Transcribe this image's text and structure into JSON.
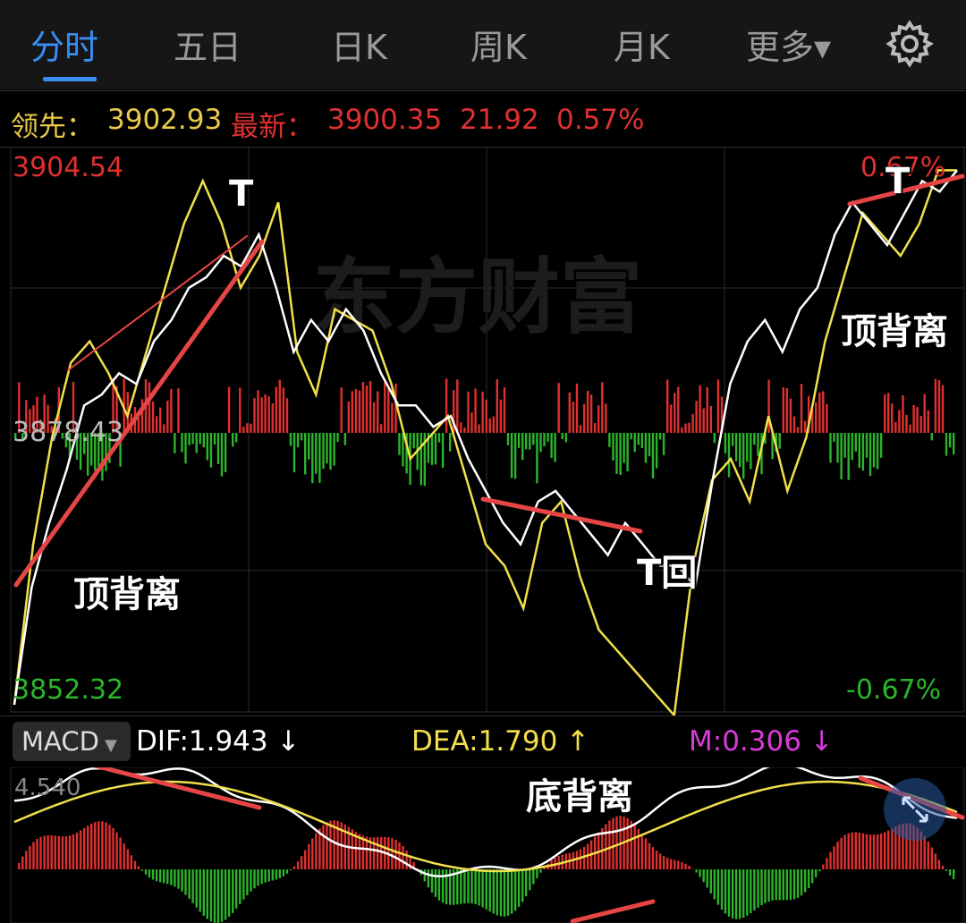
{
  "tabs": [
    {
      "label": "分时",
      "active": true
    },
    {
      "label": "五日",
      "active": false
    },
    {
      "label": "日K",
      "active": false
    },
    {
      "label": "周K",
      "active": false
    },
    {
      "label": "月K",
      "active": false
    },
    {
      "label": "更多▾",
      "active": false
    }
  ],
  "icons": {
    "settings": "gear-icon",
    "dropdown": "triangle-down-icon",
    "zoom": "expand-arrows-icon"
  },
  "header": {
    "leader_label": "领先：",
    "leader_value": "3902.93",
    "latest_label": "最新：",
    "latest_value": "3900.35",
    "change": "21.92",
    "change_pct": "0.57%"
  },
  "price_axis": {
    "high": "3904.54",
    "mid": "3878.43",
    "low": "3852.32",
    "high_pct": "0.67%",
    "low_pct": "-0.67%"
  },
  "annotations": {
    "t1": "T",
    "t2": "T",
    "t_back": "T回",
    "top_div_left": "顶背离",
    "top_div_right": "顶背离",
    "bottom_div": "底背离"
  },
  "watermark": "东方财富",
  "macd": {
    "selector": "MACD",
    "dif": "DIF:1.943 ↓",
    "dea": "DEA:1.790 ↑",
    "m": "M:0.306 ↓",
    "axis_top": "4.540"
  },
  "colors": {
    "up": "#e03030",
    "down": "#2bb52b",
    "white_line": "#ffffff",
    "yellow_line": "#f2e04a",
    "accent": "#3a8df2",
    "magenta": "#d83bd8"
  },
  "chart_data": {
    "type": "line",
    "ylim": [
      3852.32,
      3904.54
    ],
    "baseline": 3878.43,
    "series": [
      {
        "values": [
          3853,
          3864,
          3870,
          3875,
          3881,
          3882,
          3884,
          3883,
          3887,
          3889,
          3892,
          3893,
          3895,
          3894,
          3897,
          3892,
          3886,
          3889,
          3887,
          3890,
          3888,
          3884,
          3881,
          3881,
          3879,
          3880,
          3876,
          3873,
          3870,
          3868,
          3872,
          3873,
          3871,
          3869,
          3867,
          3870,
          3868,
          3866,
          3866,
          3864,
          3874,
          3883,
          3887,
          3889,
          3886,
          3890,
          3892,
          3897,
          3900,
          3898,
          3896,
          3899,
          3902,
          3901,
          3903
        ]
      },
      {
        "values": [
          3853,
          3868,
          3878,
          3885,
          3887,
          3884,
          3880,
          3886,
          3892,
          3898,
          3902,
          3898,
          3892,
          3895,
          3900,
          3886,
          3882,
          3890,
          3889,
          3888,
          3883,
          3876,
          3878,
          3880,
          3874,
          3868,
          3866,
          3862,
          3870,
          3872,
          3865,
          3860,
          3858,
          3856,
          3854,
          3852,
          3866,
          3874,
          3876,
          3872,
          3880,
          3873,
          3878,
          3887,
          3893,
          3899,
          3897,
          3895,
          3898,
          3903,
          3903
        ]
      }
    ]
  }
}
